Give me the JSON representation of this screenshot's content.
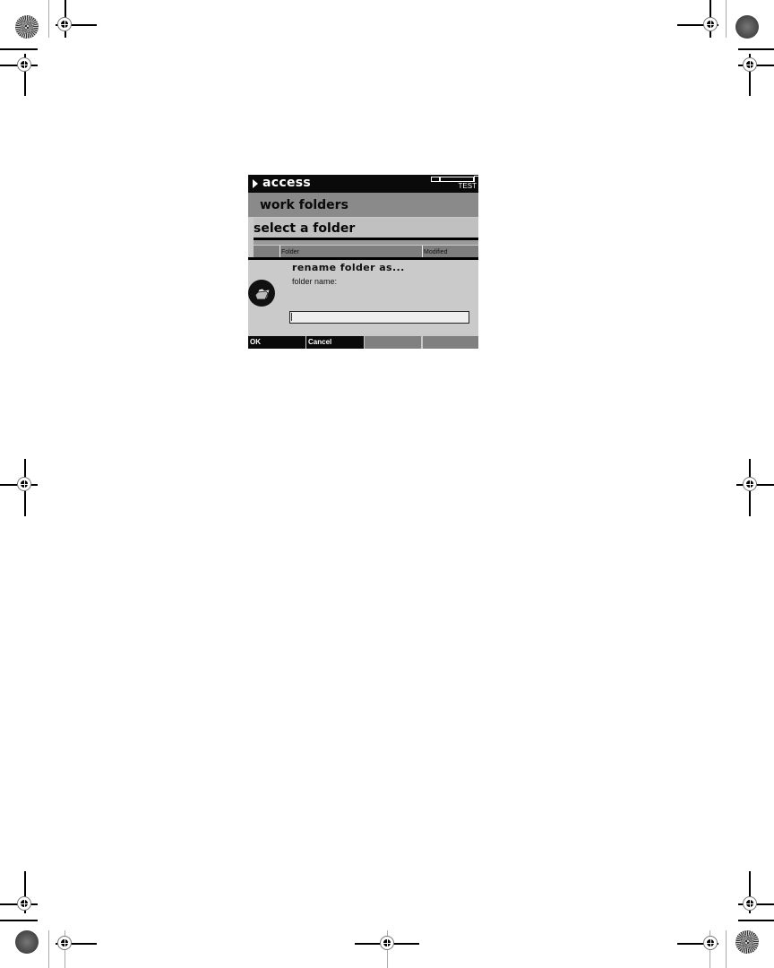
{
  "device": {
    "titlebar": {
      "title": "access",
      "status_label": "TEST",
      "icons": [
        "play-arrow-icon",
        "battery-icon",
        "power-plug-icon"
      ]
    },
    "breadcrumb": "work folders",
    "section_title": "select a folder",
    "columns": [
      "",
      "Folder",
      "Modified"
    ],
    "dialog": {
      "icon": "folder-icon",
      "title": "rename folder as...",
      "field_label": "folder name:",
      "field_value": "",
      "field_placeholder": ""
    },
    "softkeys": [
      {
        "label": "OK",
        "active": true
      },
      {
        "label": "Cancel",
        "active": true
      },
      {
        "label": "",
        "active": false
      },
      {
        "label": "",
        "active": false
      }
    ]
  },
  "page_marks": {
    "registration_marks": "crop-registration-icon",
    "color_bars": "starburst-target-icon"
  },
  "colors": {
    "titlebar_bg": "#0a0a0a",
    "dialog_bg": "#cacaca",
    "softkey_active": "#0a0a0a",
    "softkey_inactive": "#808080"
  }
}
